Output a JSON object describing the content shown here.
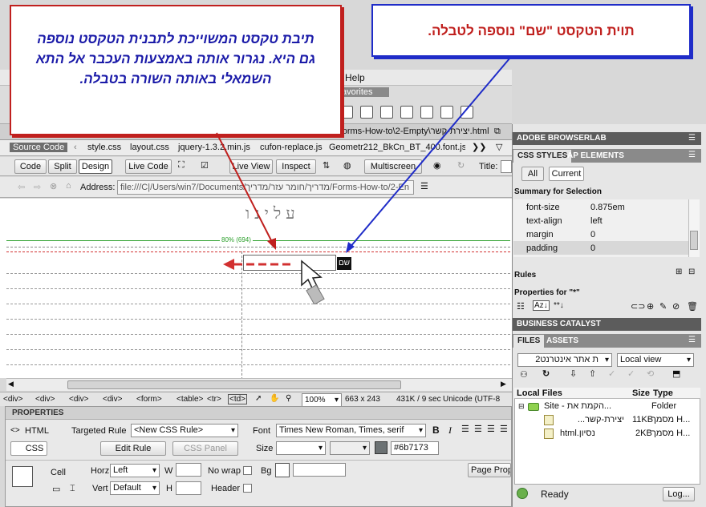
{
  "callouts": {
    "left_text": "תיבת טקסט המשוייכת לתבנית הטקסט נוספה גם היא. נגרור אותה באמצעות העכבר אל התא השמאלי באותה השורה בטבלה.",
    "right_text": "תוית הטקסט \"שם\" נוספה לטבלה.",
    "text_color": "#1a1aa8",
    "left_border": "#c0201e",
    "right_border": "#1f2cc8"
  },
  "menu": {
    "help": "Help",
    "favorites": "avorites"
  },
  "doc_tabs": {
    "file_tab": "Forms-How-to\\2-Empty\\יצירת-קשר.html"
  },
  "related_files": {
    "source_code": "Source Code",
    "files": [
      "style.css",
      "layout.css",
      "jquery-1.3.2.min.js",
      "cufon-replace.js",
      "Geometr212_BkCn_BT_400.font.js"
    ]
  },
  "doc_toolbar": {
    "code": "Code",
    "split": "Split",
    "design": "Design",
    "live_code": "Live Code",
    "live_view": "Live View",
    "inspect": "Inspect",
    "multiscreen": "Multiscreen",
    "title_label": "Title:"
  },
  "address": {
    "label": "Address:",
    "value": "file:///C|/Users/win7/Documents/מדריך/חומר עזר/מדריך/Forms-How-to/2-En"
  },
  "design_view": {
    "heading": "עלינו",
    "ruler_label": "80% (694)",
    "name_label": "שם"
  },
  "status_bar": {
    "tags": [
      "<div>",
      "<div>",
      "<div>",
      "<div>",
      "<form>",
      "<table>",
      "<tr>",
      "<td>"
    ],
    "zoom": "100%",
    "size": "663 x 243",
    "weight": "431K / 9 sec",
    "encoding": "Unicode (UTF-8"
  },
  "properties": {
    "title": "PROPERTIES",
    "html_btn": "HTML",
    "css_btn": "CSS",
    "targeted_rule_label": "Targeted Rule",
    "targeted_rule_value": "<New CSS Rule>",
    "edit_rule": "Edit Rule",
    "css_panel": "CSS Panel",
    "font_label": "Font",
    "font_value": "Times New Roman, Times, serif",
    "size_label": "Size",
    "color_value": "#6b7173",
    "cell_label": "Cell",
    "horz_label": "Horz",
    "horz_value": "Left",
    "vert_label": "Vert",
    "vert_value": "Default",
    "w_label": "W",
    "h_label": "H",
    "nowrap_label": "No wrap",
    "bg_label": "Bg",
    "header_label": "Header",
    "page_props": "Page Prope",
    "bold": "B",
    "italic": "I"
  },
  "browserlab": {
    "title": "ADOBE BROWSERLAB"
  },
  "css_styles": {
    "tab_styles": "CSS STYLES",
    "tab_ap": "AP ELEMENTS",
    "all": "All",
    "current": "Current",
    "summary_title": "Summary for Selection",
    "props": [
      {
        "name": "font-size",
        "value": "0.875em"
      },
      {
        "name": "text-align",
        "value": "left"
      },
      {
        "name": "margin",
        "value": "0"
      },
      {
        "name": "padding",
        "value": "0"
      }
    ],
    "rules": "Rules",
    "properties_for": "Properties for \"*\""
  },
  "business_catalyst": {
    "title": "BUSINESS CATALYST"
  },
  "files_panel": {
    "tab_files": "FILES",
    "tab_assets": "ASSETS",
    "site_select": "ת אתר אינטרנט2",
    "view_select": "Local view",
    "col_local": "Local Files",
    "col_size": "Size",
    "col_type": "Type",
    "rows": [
      {
        "name": "Site - הקמת את...",
        "size": "",
        "type": "Folder"
      },
      {
        "name": "יצירת-קשר...",
        "size": "11KB",
        "type": "מסמך H..."
      },
      {
        "name": "נסיון.html",
        "size": "2KB",
        "type": "מסמך H..."
      }
    ],
    "ready": "Ready",
    "log": "Log..."
  }
}
